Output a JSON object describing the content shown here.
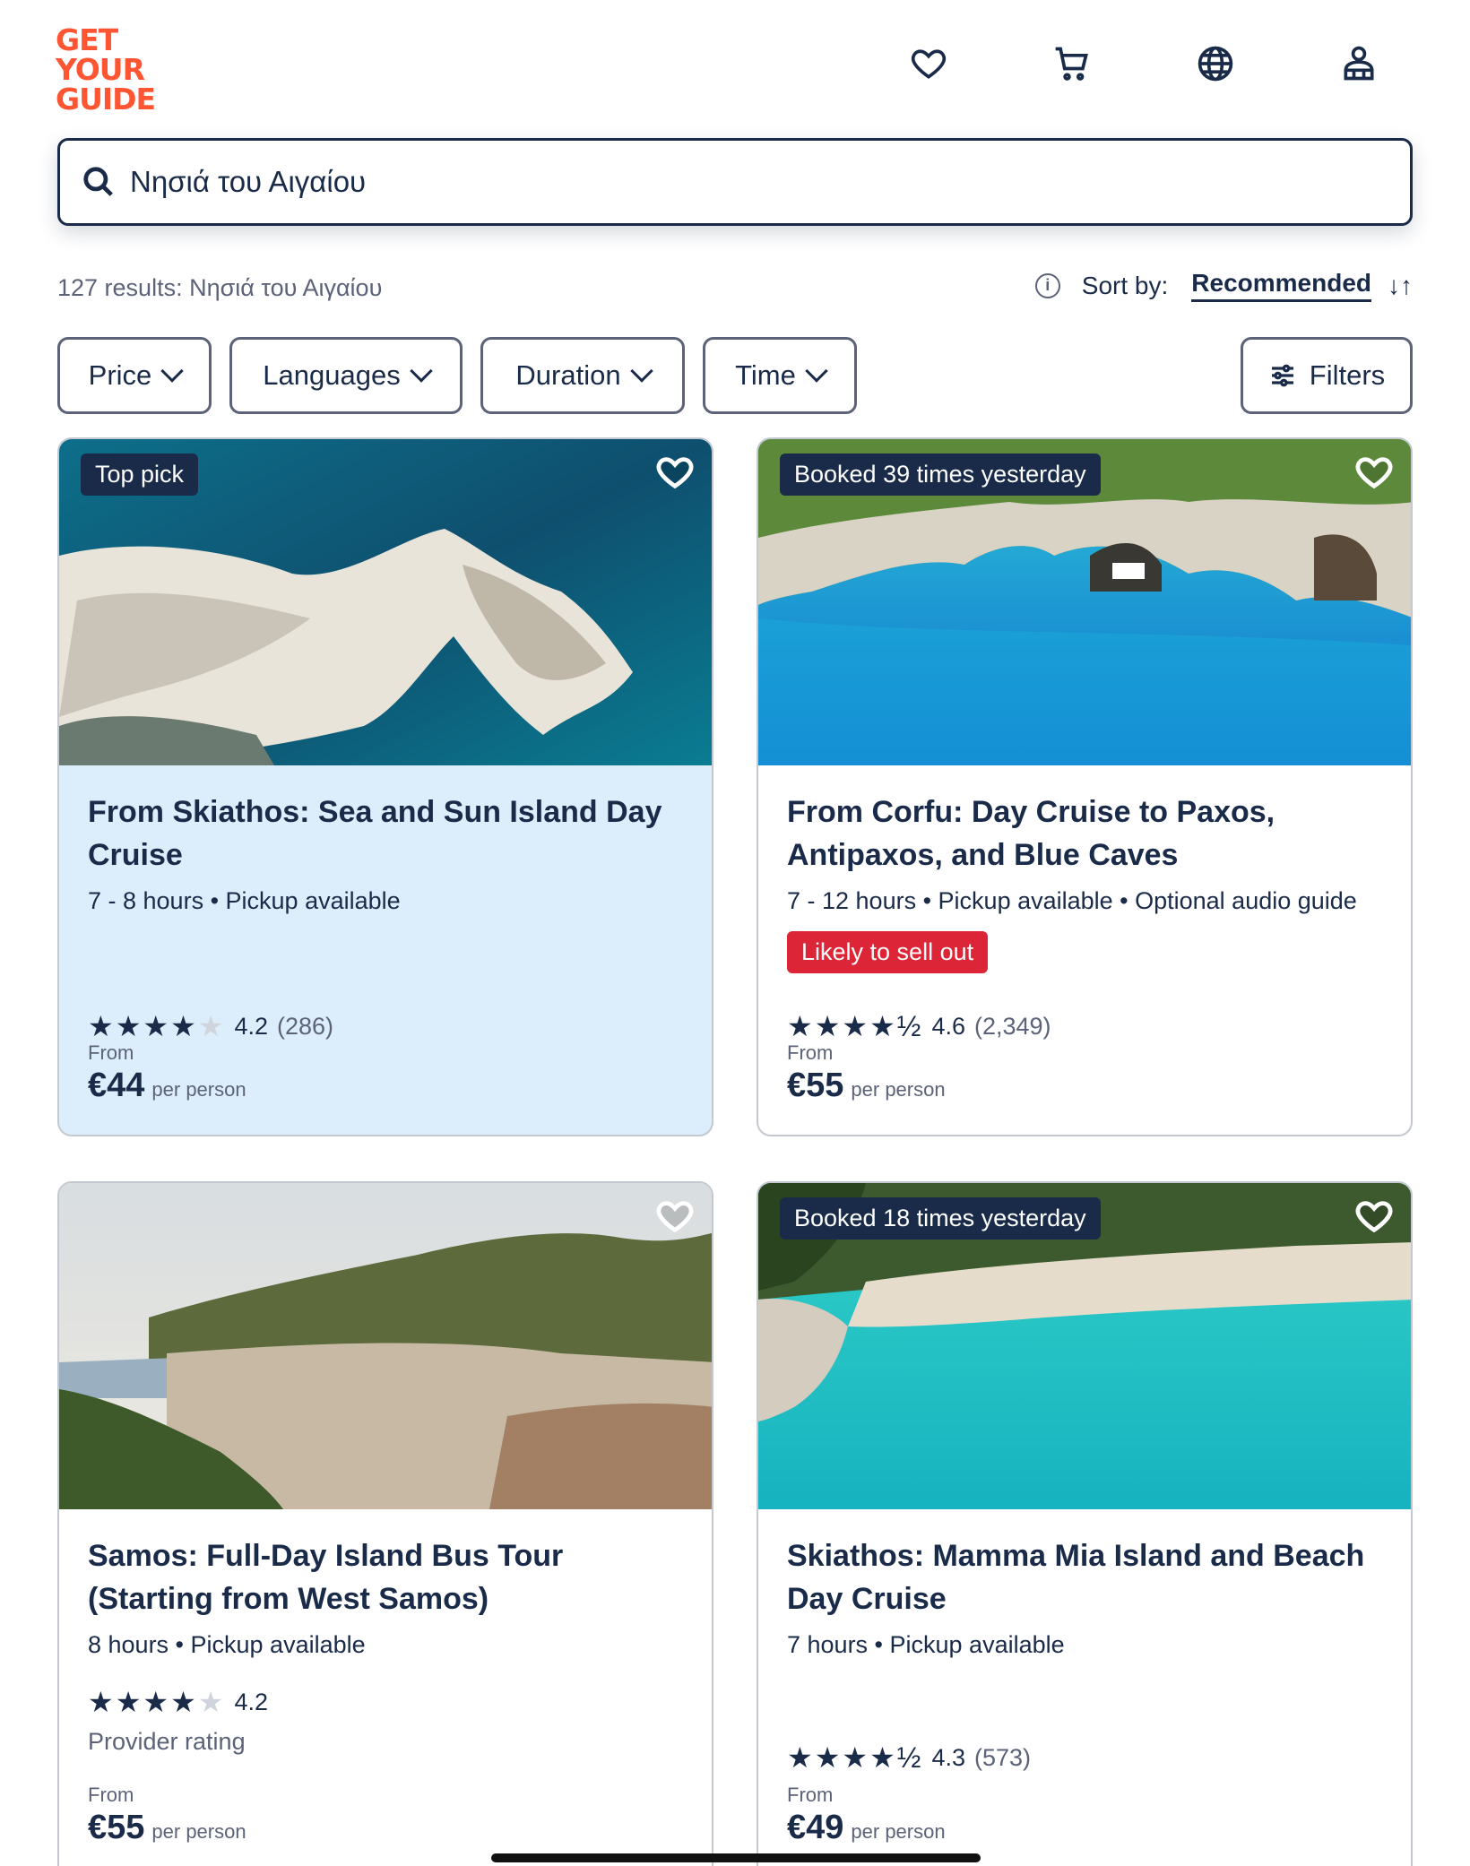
{
  "brand": {
    "logo_lines": [
      "GET",
      "YOUR",
      "GUIDE"
    ],
    "color": "#ff5533"
  },
  "header": {
    "icons": [
      "heart-icon",
      "cart-icon",
      "globe-icon",
      "profile-icon"
    ]
  },
  "search": {
    "value": "Νησιά του Αιγαίου",
    "placeholder": ""
  },
  "results": {
    "count_text": "127 results: Νησιά του Αιγαίου"
  },
  "sort": {
    "label": "Sort by:",
    "value": "Recommended"
  },
  "filters": {
    "price": "Price",
    "languages": "Languages",
    "duration": "Duration",
    "time": "Time",
    "more": "Filters"
  },
  "cards": [
    {
      "badge": "Top pick",
      "title": "From Skiathos: Sea and Sun Island Day Cruise",
      "meta": "7 - 8 hours • Pickup available",
      "urgent": "",
      "rating": "4.2",
      "reviews": "(286)",
      "from": "From",
      "price": "€44",
      "per": "per person"
    },
    {
      "badge": "Booked 39 times yesterday",
      "title": "From Corfu: Day Cruise to Paxos, Antipaxos, and Blue Caves",
      "meta": "7 - 12 hours • Pickup available • Optional audio guide",
      "urgent": "Likely to sell out",
      "rating": "4.6",
      "reviews": "(2,349)",
      "from": "From",
      "price": "€55",
      "per": "per person"
    },
    {
      "badge": "",
      "title": "Samos: Full-Day Island Bus Tour (Starting from West Samos)",
      "meta": "8 hours • Pickup available",
      "urgent": "",
      "rating": "4.2",
      "reviews": "",
      "provider": "Provider rating",
      "from": "From",
      "price": "€55",
      "per": "per person"
    },
    {
      "badge": "Booked 18 times yesterday",
      "title": "Skiathos: Mamma Mia Island and Beach Day Cruise",
      "meta": "7 hours • Pickup available",
      "urgent": "",
      "rating": "4.3",
      "reviews": "(573)",
      "from": "From",
      "price": "€49",
      "per": "per person"
    }
  ],
  "colors": {
    "navy": "#1a2b49",
    "highlight": "#dceefb",
    "urgent": "#dc2638"
  }
}
